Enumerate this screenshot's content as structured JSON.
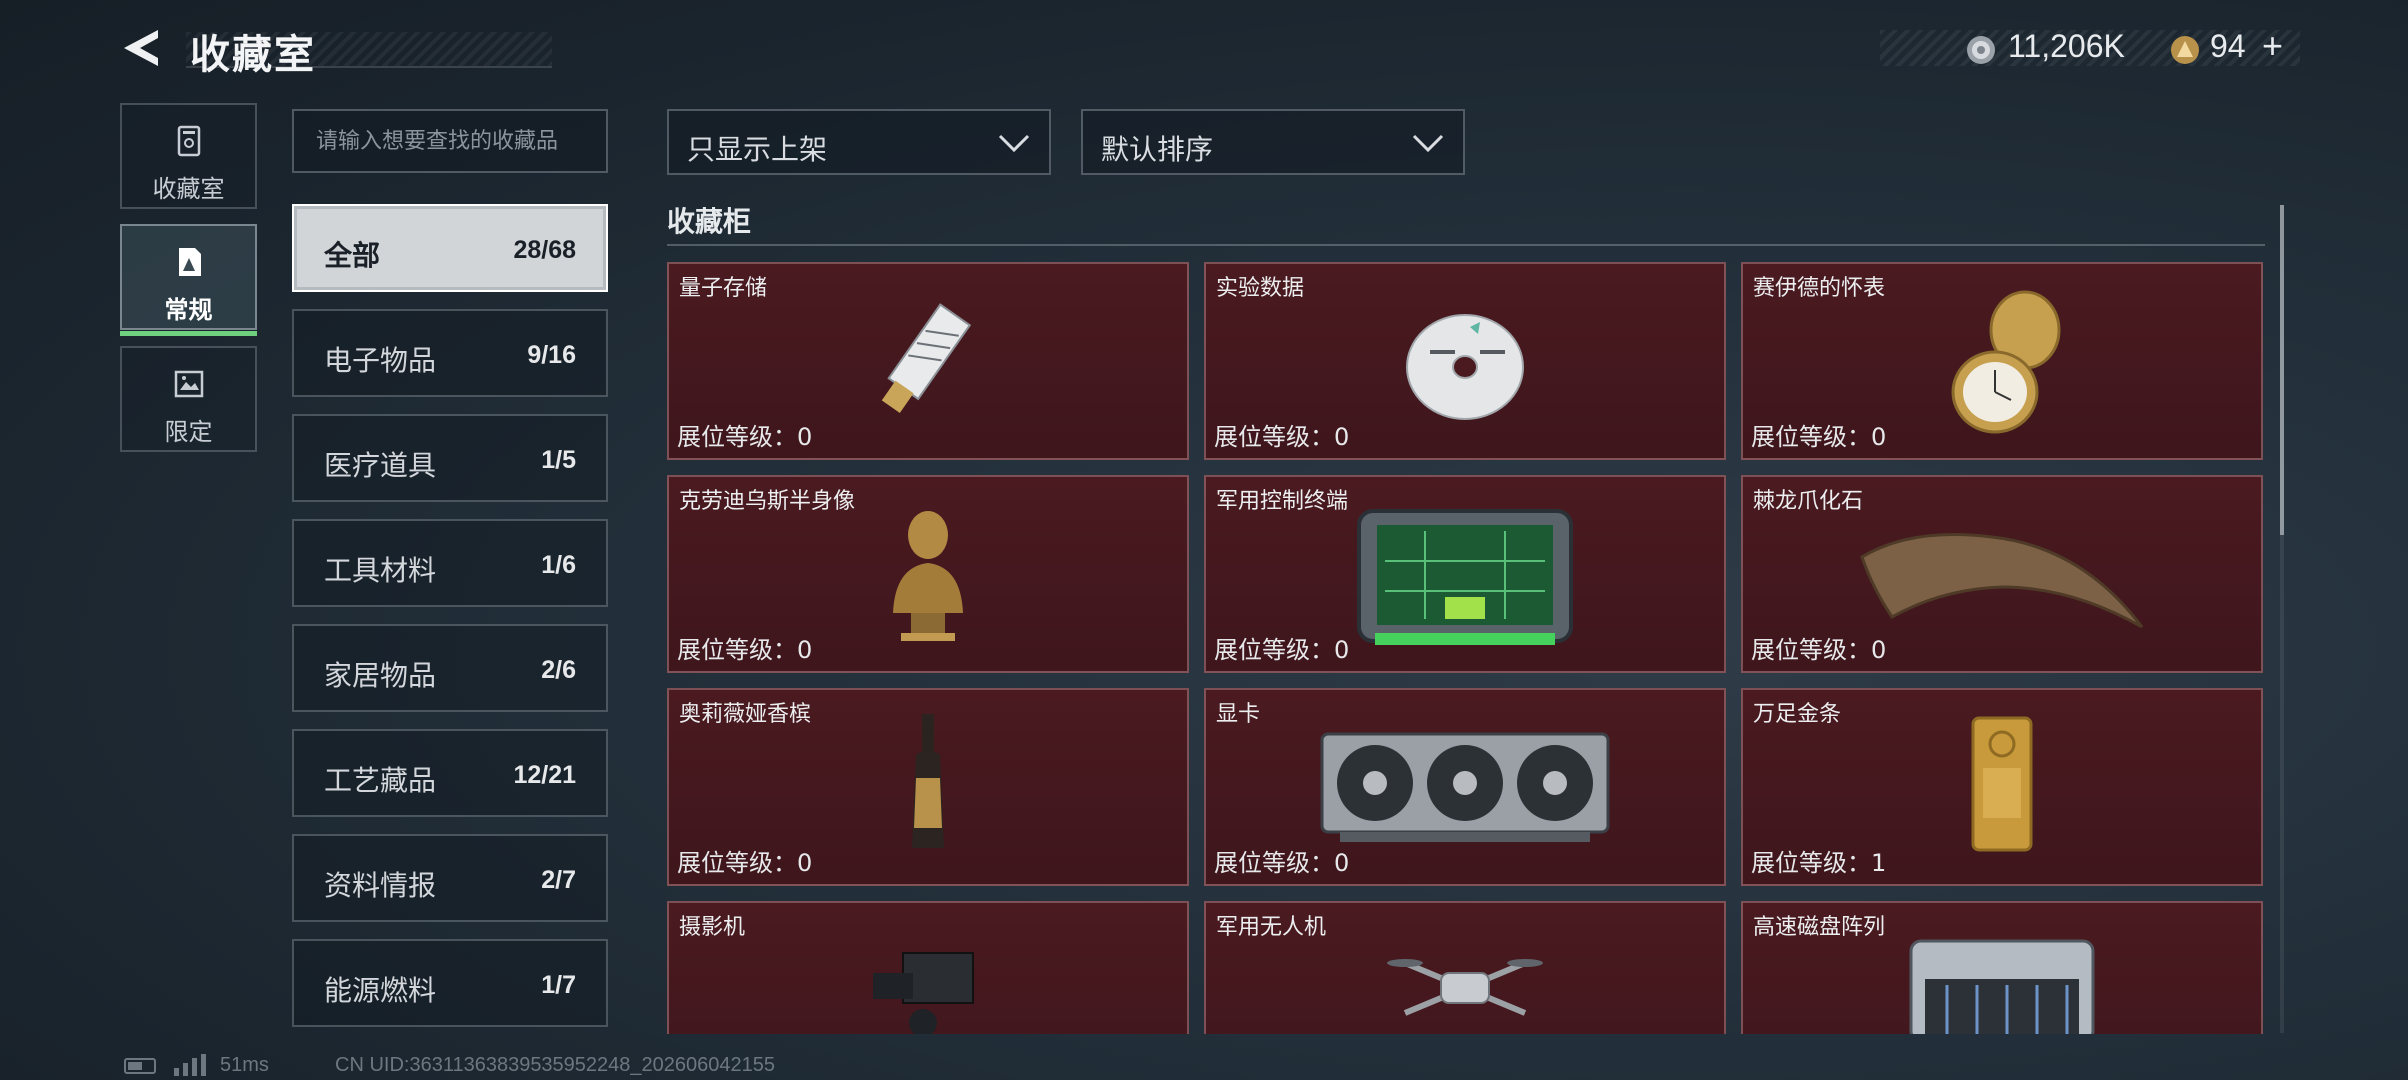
{
  "header": {
    "title": "收藏室",
    "currencies": [
      {
        "icon": "silver-coin-icon",
        "value": "11,206K"
      },
      {
        "icon": "gold-coin-icon",
        "value": "94"
      }
    ],
    "add_symbol": "+"
  },
  "side_nav": [
    {
      "label": "收藏室",
      "icon": "collection-room-icon",
      "active": false
    },
    {
      "label": "常规",
      "icon": "regular-icon",
      "active": true
    },
    {
      "label": "限定",
      "icon": "limited-icon",
      "active": false
    }
  ],
  "search": {
    "placeholder": "请输入想要查找的收藏品",
    "value": ""
  },
  "categories": [
    {
      "name": "全部",
      "count": "28/68",
      "active": true
    },
    {
      "name": "电子物品",
      "count": "9/16",
      "active": false
    },
    {
      "name": "医疗道具",
      "count": "1/5",
      "active": false
    },
    {
      "name": "工具材料",
      "count": "1/6",
      "active": false
    },
    {
      "name": "家居物品",
      "count": "2/6",
      "active": false
    },
    {
      "name": "工艺藏品",
      "count": "12/21",
      "active": false
    },
    {
      "name": "资料情报",
      "count": "2/7",
      "active": false
    },
    {
      "name": "能源燃料",
      "count": "1/7",
      "active": false
    }
  ],
  "filters": {
    "filter_label": "只显示上架",
    "sort_label": "默认排序"
  },
  "section": {
    "title": "收藏柜",
    "level_prefix": "展位等级："
  },
  "items": [
    {
      "name": "量子存储",
      "level": "0"
    },
    {
      "name": "实验数据",
      "level": "0"
    },
    {
      "name": "赛伊德的怀表",
      "level": "0"
    },
    {
      "name": "克劳迪乌斯半身像",
      "level": "0"
    },
    {
      "name": "军用控制终端",
      "level": "0"
    },
    {
      "name": "棘龙爪化石",
      "level": "0"
    },
    {
      "name": "奥莉薇娅香槟",
      "level": "0"
    },
    {
      "name": "显卡",
      "level": "0"
    },
    {
      "name": "万足金条",
      "level": "1"
    },
    {
      "name": "摄影机",
      "level": ""
    },
    {
      "name": "军用无人机",
      "level": ""
    },
    {
      "name": "高速磁盘阵列",
      "level": ""
    }
  ],
  "status_bar": {
    "ping": "51ms",
    "uid": "CN UID:36311363839535952248_202606042155"
  },
  "colors": {
    "accent_green": "#6fd07d",
    "card_bg": "#4a1a20",
    "background": "#1f2a34"
  }
}
